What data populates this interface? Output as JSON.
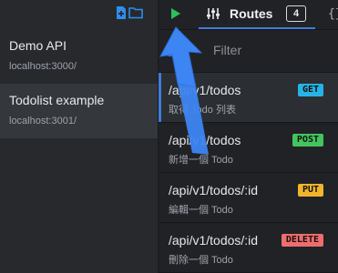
{
  "colors": {
    "accent": "#3f7cd9",
    "play_green": "#2fbf5a",
    "get": "#27b2e6",
    "post": "#43c45c",
    "put": "#f0b52a",
    "delete": "#f06d6d",
    "pointer_arrow": "#3d85f2"
  },
  "sidebar": {
    "toolbar_icons": [
      "new-environment-icon",
      "open-folder-icon"
    ],
    "environments": [
      {
        "name": "Demo API",
        "host": "localhost:3000/"
      },
      {
        "name": "Todolist example",
        "host": "localhost:3001/"
      }
    ]
  },
  "header": {
    "play_icon": "play-icon",
    "routes_tab": {
      "label": "Routes",
      "count": "4",
      "icon": "routes-icon"
    },
    "next_tab_icon": "{}"
  },
  "filter": {
    "placeholder": "Filter",
    "value": ""
  },
  "routes": [
    {
      "path": "/api/v1/todos",
      "description": "取得 Todo 列表",
      "method": "GET"
    },
    {
      "path": "/api/v1/todos",
      "description": "新增一個 Todo",
      "method": "POST"
    },
    {
      "path": "/api/v1/todos/:id",
      "description": "編輯一個 Todo",
      "method": "PUT"
    },
    {
      "path": "/api/v1/todos/:id",
      "description": "刪除一個 Todo",
      "method": "DELETE"
    }
  ]
}
